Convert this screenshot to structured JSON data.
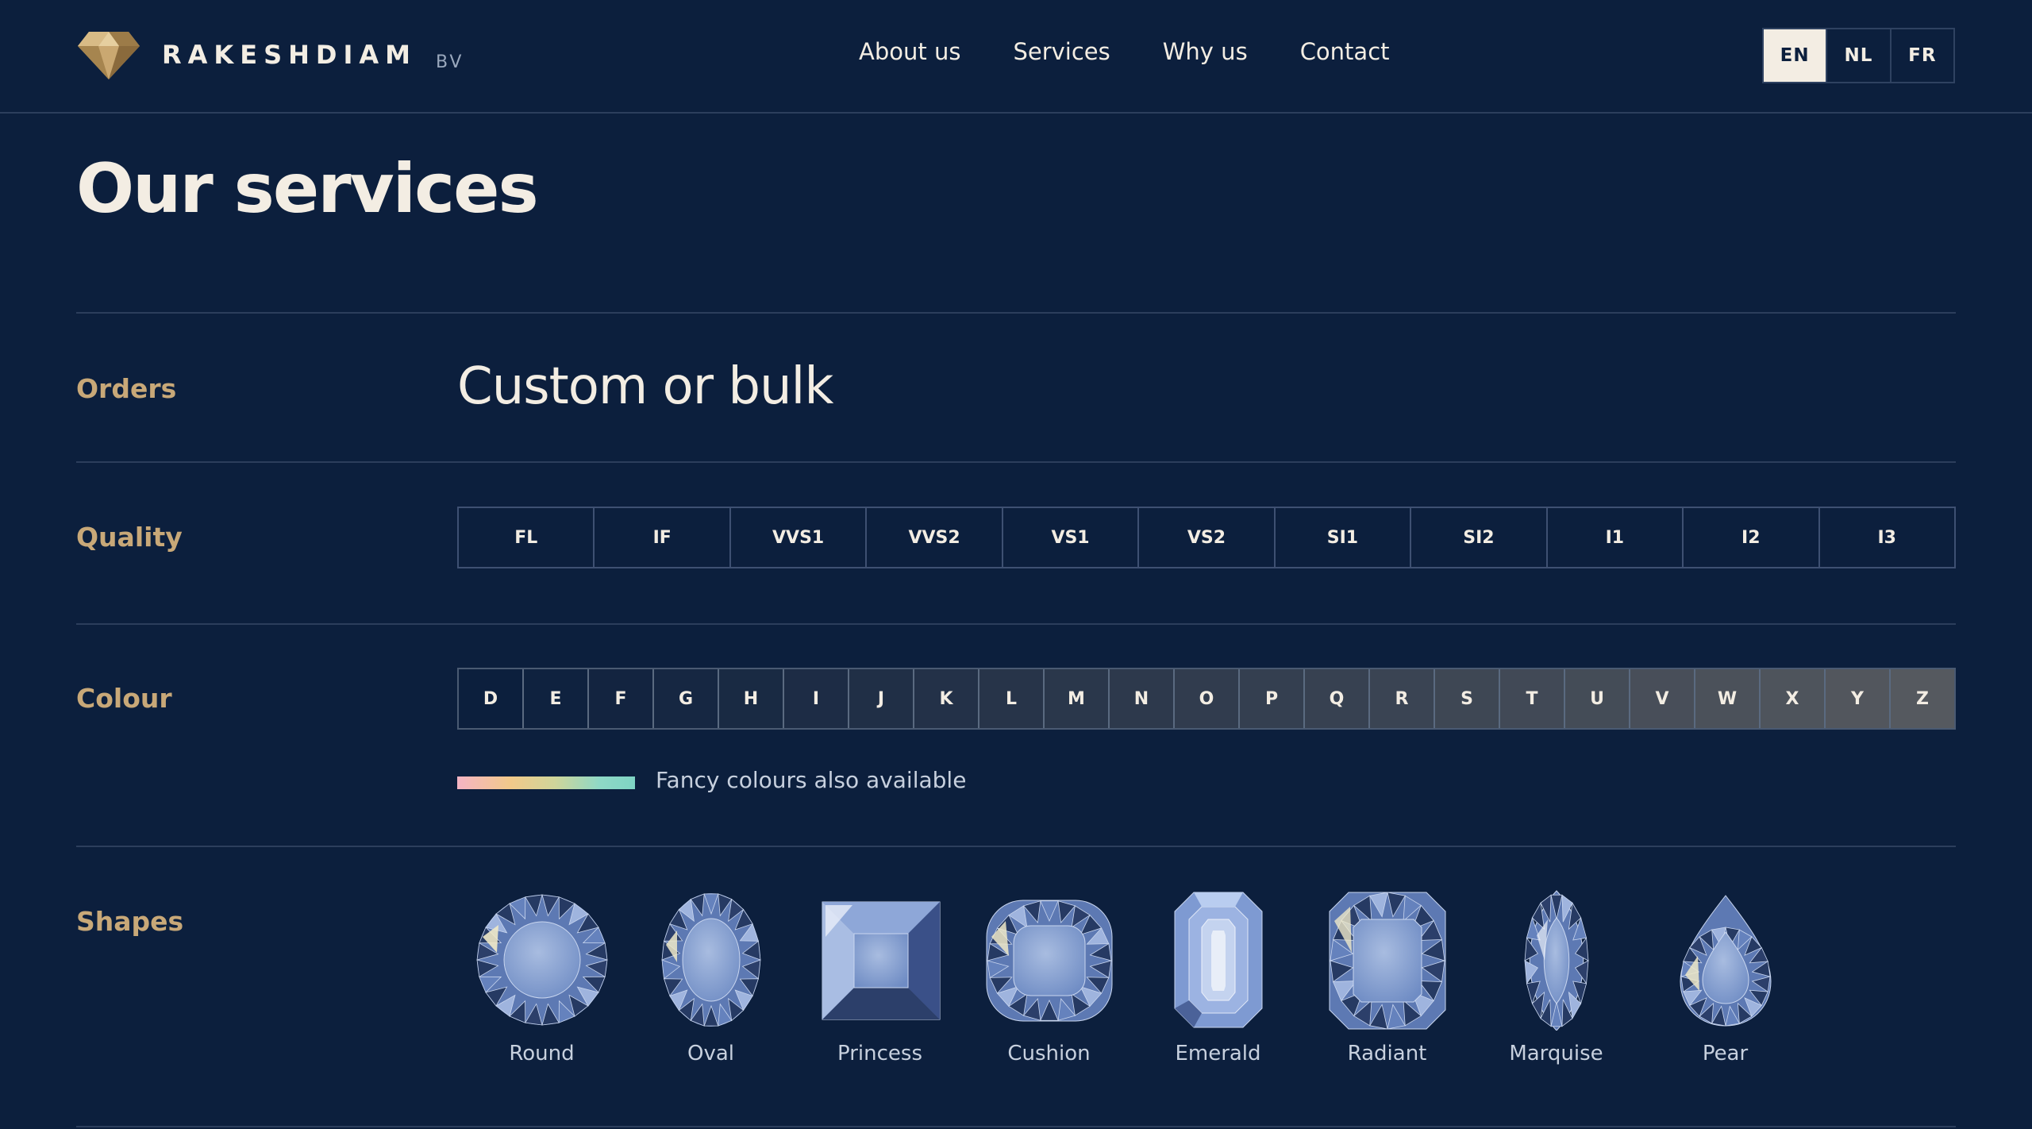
{
  "header": {
    "brand": "RAKESHDIAM",
    "brand_suffix": "BV",
    "nav": [
      {
        "label": "About us"
      },
      {
        "label": "Services"
      },
      {
        "label": "Why us"
      },
      {
        "label": "Contact"
      }
    ],
    "languages": [
      {
        "code": "EN",
        "active": true
      },
      {
        "code": "NL",
        "active": false
      },
      {
        "code": "FR",
        "active": false
      }
    ]
  },
  "page": {
    "title": "Our services"
  },
  "sections": {
    "orders": {
      "label": "Orders",
      "value": "Custom or bulk"
    },
    "quality": {
      "label": "Quality",
      "grades": [
        "FL",
        "IF",
        "VVS1",
        "VVS2",
        "VS1",
        "VS2",
        "SI1",
        "SI2",
        "I1",
        "I2",
        "I3"
      ]
    },
    "colour": {
      "label": "Colour",
      "grades": [
        "D",
        "E",
        "F",
        "G",
        "H",
        "I",
        "J",
        "K",
        "L",
        "M",
        "N",
        "O",
        "P",
        "Q",
        "R",
        "S",
        "T",
        "U",
        "V",
        "W",
        "X",
        "Y",
        "Z"
      ],
      "gradient_from": "#0c1f3d",
      "gradient_to": "#55595f",
      "fancy_note": "Fancy colours also available"
    },
    "shapes": {
      "label": "Shapes",
      "items": [
        {
          "label": "Round",
          "icon": "round-diamond-icon"
        },
        {
          "label": "Oval",
          "icon": "oval-diamond-icon"
        },
        {
          "label": "Princess",
          "icon": "princess-diamond-icon"
        },
        {
          "label": "Cushion",
          "icon": "cushion-diamond-icon"
        },
        {
          "label": "Emerald",
          "icon": "emerald-diamond-icon"
        },
        {
          "label": "Radiant",
          "icon": "radiant-diamond-icon"
        },
        {
          "label": "Marquise",
          "icon": "marquise-diamond-icon"
        },
        {
          "label": "Pear",
          "icon": "pear-diamond-icon"
        }
      ]
    }
  },
  "colors": {
    "background": "#0c1f3d",
    "accent_gold": "#c8a878",
    "text_light": "#f3ede3",
    "diamond_blue": "#7b97cc"
  }
}
